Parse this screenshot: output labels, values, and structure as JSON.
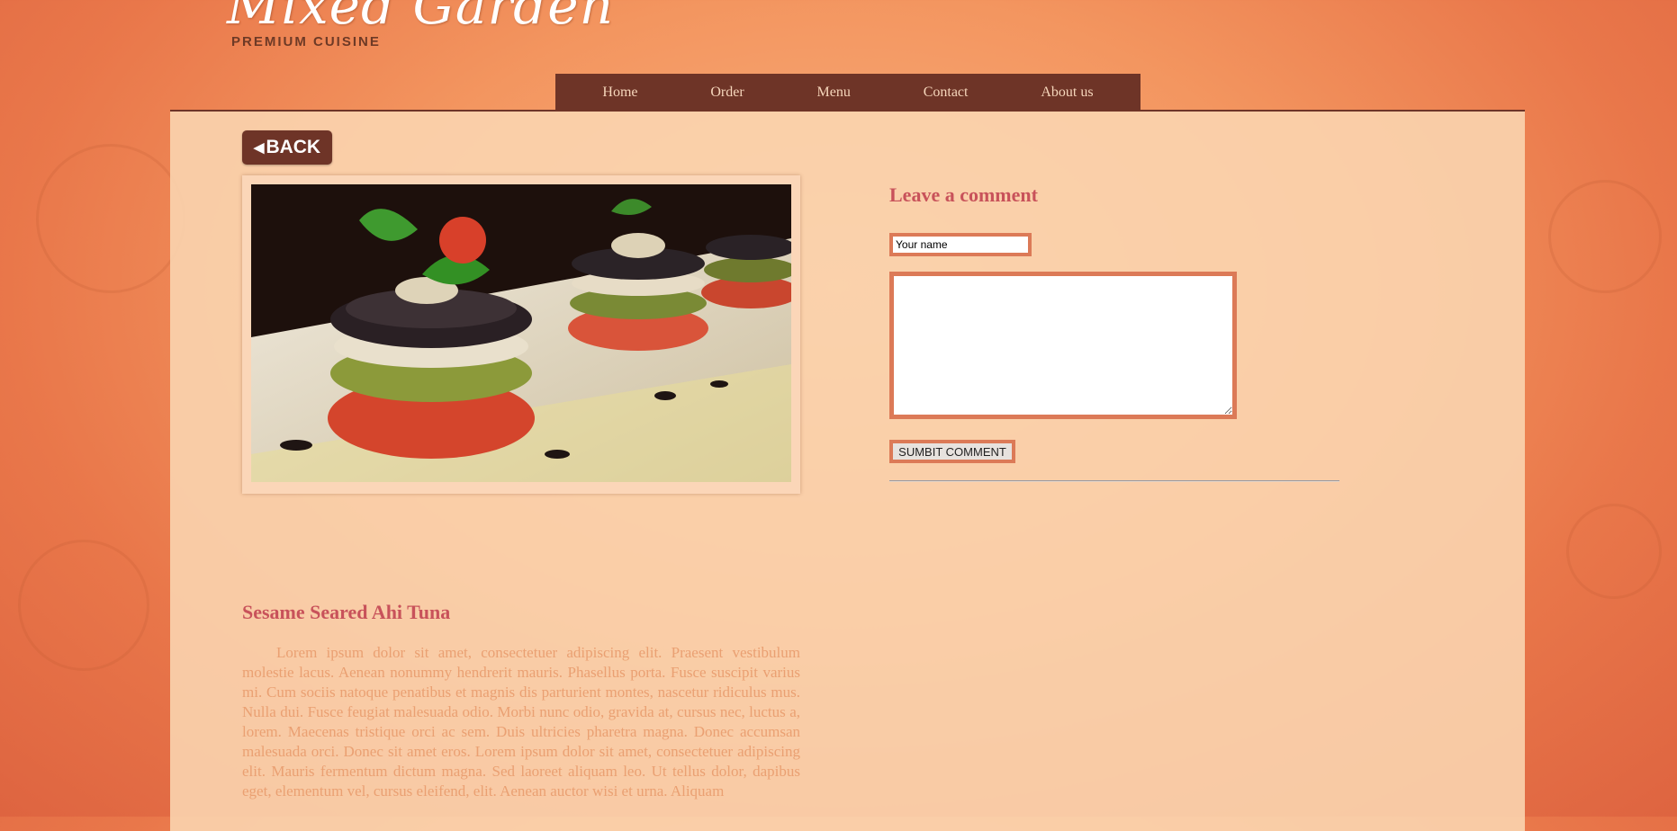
{
  "header": {
    "logo_text": "Mixed Garden",
    "tagline": "PREMIUM CUISINE"
  },
  "nav": {
    "items": [
      "Home",
      "Order",
      "Menu",
      "Contact",
      "About us"
    ]
  },
  "back_button": {
    "label": "BACK",
    "icon": "triangle-left-icon"
  },
  "photo": {
    "description_alt": ""
  },
  "comment_form": {
    "title": "Leave a comment",
    "name_value": "Your name",
    "comment_value": "",
    "submit_label": "SUMBIT COMMENT"
  },
  "dish": {
    "title": "Sesame Seared Ahi Tuna",
    "text": "Lorem ipsum dolor sit amet, consectetuer adipiscing elit. Praesent vestibulum molestie lacus. Aenean nonummy hendrerit mauris. Phasellus porta. Fusce suscipit varius mi. Cum sociis natoque penatibus et magnis dis parturient montes, nascetur ridiculus mus. Nulla dui. Fusce feugiat malesuada odio. Morbi nunc odio, gravida at, cursus nec, luctus a, lorem. Maecenas tristique orci ac sem. Duis ultricies pharetra magna. Donec accumsan malesuada orci. Donec sit amet eros. Lorem ipsum dolor sit amet, consectetuer adipiscing elit. Mauris fermentum dictum magna. Sed laoreet aliquam leo. Ut tellus dolor, dapibus eget, elementum vel, cursus eleifend, elit. Aenean auctor wisi et urna. Aliquam"
  },
  "colors": {
    "nav_bg": "#6e3427",
    "accent_title": "#c8525a",
    "body_text": "#eaa072",
    "input_border": "#dc7a57"
  }
}
